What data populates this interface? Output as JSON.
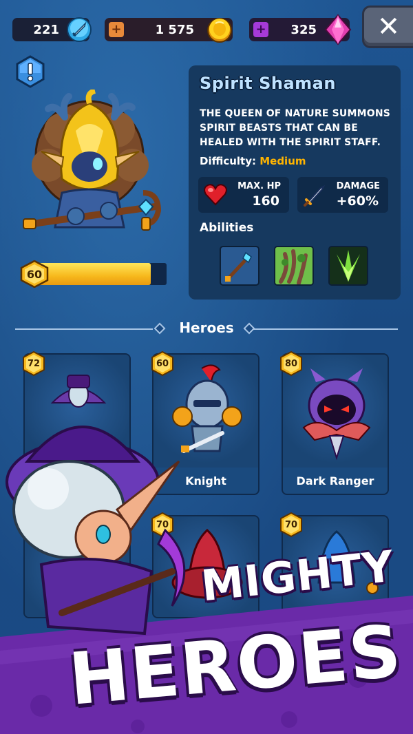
{
  "currency": {
    "gems": "221",
    "gold": "1 575",
    "premium": "325"
  },
  "close_icon": "close-x",
  "selected_hero": {
    "level": "60",
    "xp_progress": 0.88,
    "name": "Spirit Shaman",
    "description": "The queen of nature summons spirit beasts that can be healed with the Spirit Staff.",
    "difficulty_label": "Difficulty:",
    "difficulty_value": "Medium",
    "stats": [
      {
        "label": "MAX. HP",
        "value": "160",
        "icon": "heart-icon"
      },
      {
        "label": "DAMAGE",
        "value": "+60%",
        "icon": "sword-icon"
      }
    ],
    "abilities_label": "Abilities",
    "abilities": [
      "spirit-staff-icon",
      "vine-roots-icon",
      "spirit-burst-icon"
    ]
  },
  "heroes_section": {
    "title": "Heroes",
    "cards": [
      {
        "level": "72",
        "name": ""
      },
      {
        "level": "60",
        "name": "Knight"
      },
      {
        "level": "80",
        "name": "Dark Ranger"
      },
      {
        "level": "",
        "name": ""
      },
      {
        "level": "70",
        "name": ""
      },
      {
        "level": "70",
        "name": ""
      }
    ]
  },
  "promo": {
    "line1": "MIGHTY",
    "line2": "HEROES"
  },
  "colors": {
    "background": "#1b4e86",
    "panel": "#16395f",
    "accent_gold": "#ffb400",
    "promo_purple": "#6a2aa8"
  }
}
